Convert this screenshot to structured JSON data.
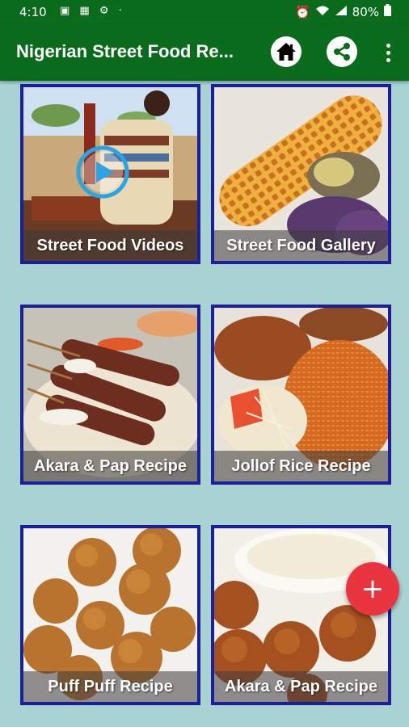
{
  "status_bar": {
    "time": "4:10",
    "battery": "80%",
    "icons_left": [
      "image-icon",
      "photo-icon",
      "settings-icon",
      "dot"
    ],
    "icons_right": [
      "alarm-icon",
      "wifi-icon",
      "signal-icon",
      "battery-icon"
    ]
  },
  "app_bar": {
    "title": "Nigerian Street Food Re...",
    "home_icon": "home-icon",
    "share_icon": "share-icon",
    "more_icon": "more-vert-icon"
  },
  "tiles": [
    {
      "label": "Street Food Videos"
    },
    {
      "label": "Street Food Gallery"
    },
    {
      "label": "Akara & Pap Recipe"
    },
    {
      "label": "Jollof Rice Recipe"
    },
    {
      "label": "Puff Puff Recipe"
    },
    {
      "label": "Akara & Pap Recipe"
    }
  ],
  "fab": {
    "label": "+",
    "icon": "add-icon"
  },
  "colors": {
    "app_bar": "#0a6b1c",
    "background": "#a9d3d3",
    "tile_border": "#1c1f9a",
    "fab": "#e8353f"
  }
}
